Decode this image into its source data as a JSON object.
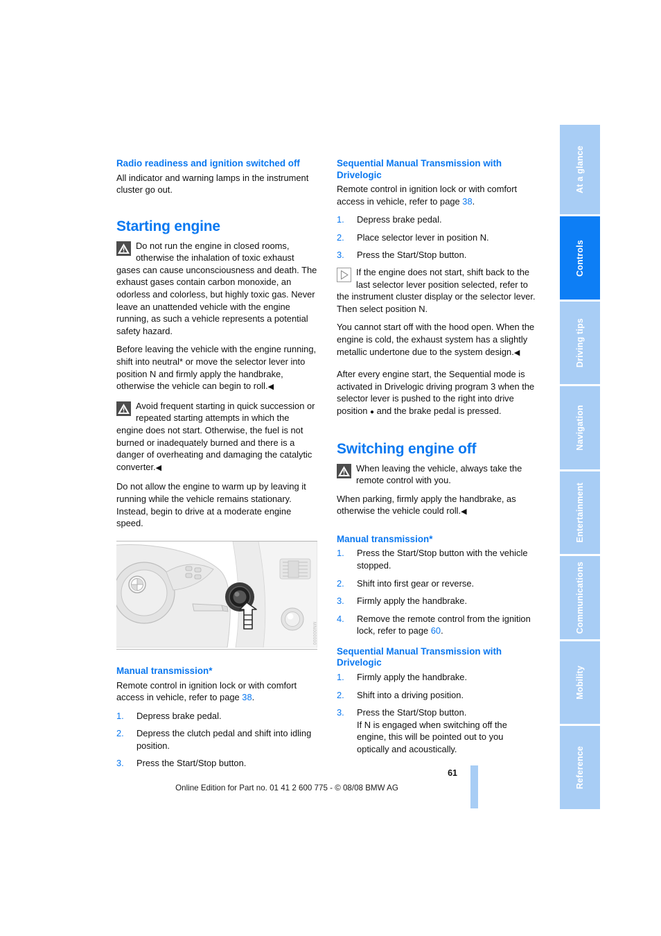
{
  "document": {
    "page_number": "61",
    "edition_line": "Online Edition for Part no. 01 41 2 600 775 - © 08/08 BMW AG",
    "accent_color": "#0a78f0",
    "tab_active_color": "#0d7ef5",
    "tab_inactive_color": "#a8cdf5"
  },
  "tabs": [
    {
      "label": "At a glance",
      "active": false
    },
    {
      "label": "Controls",
      "active": true
    },
    {
      "label": "Driving tips",
      "active": false
    },
    {
      "label": "Navigation",
      "active": false
    },
    {
      "label": "Entertainment",
      "active": false
    },
    {
      "label": "Communications",
      "active": false
    },
    {
      "label": "Mobility",
      "active": false
    },
    {
      "label": "Reference",
      "active": false
    }
  ],
  "left_column": {
    "radio_heading": "Radio readiness and ignition switched off",
    "radio_body": "All indicator and warning lamps in the instrument cluster go out.",
    "starting_engine_heading": "Starting engine",
    "warning1": "Do not run the engine in closed rooms, otherwise the inhalation of toxic exhaust gases can cause unconsciousness and death. The exhaust gases contain carbon monoxide, an odorless and colorless, but highly toxic gas. Never leave an unattended vehicle with the engine running, as such a vehicle represents a potential safety hazard.",
    "warning1_cont": "Before leaving the vehicle with the engine running, shift into neutral",
    "warning1_cont2": " or move the selector lever into position N and firmly apply the handbrake, otherwise the vehicle can begin to roll.",
    "warning2": "Avoid frequent starting in quick succession or repeated starting attempts in which the engine does not start. Otherwise, the fuel is not burned or inadequately burned and there is a danger of overheating and damaging the catalytic converter.",
    "warm_up_body": "Do not allow the engine to warm up by leaving it running while the vehicle remains stationary. Instead, begin to drive at a moderate engine speed.",
    "figure_code": "MN000000",
    "manual_heading": "Manual transmission*",
    "manual_intro_a": "Remote control in ignition lock or with comfort access in vehicle, refer to page ",
    "manual_intro_page": "38",
    "manual_intro_b": ".",
    "manual_steps": [
      {
        "num": "1.",
        "text": "Depress brake pedal."
      },
      {
        "num": "2.",
        "text": "Depress the clutch pedal and shift into idling position."
      },
      {
        "num": "3.",
        "text": "Press the Start/Stop button."
      }
    ]
  },
  "right_column": {
    "smg_heading": "Sequential Manual Transmission with Drivelogic",
    "smg_intro_a": "Remote control in ignition lock or with comfort access in vehicle, refer to page ",
    "smg_intro_page": "38",
    "smg_intro_b": ".",
    "smg_steps": [
      {
        "num": "1.",
        "text": "Depress brake pedal."
      },
      {
        "num": "2.",
        "text": "Place selector lever in position N."
      },
      {
        "num": "3.",
        "text": "Press the Start/Stop button."
      }
    ],
    "note1": "If the engine does not start, shift back to the last selector lever position selected, refer to the instrument cluster display or the selector lever. Then select position N.",
    "note1_cont": "You cannot start off with the hood open. When the engine is cold, the exhaust system has a slightly metallic undertone due to the system design.",
    "smg_after_a": "After every engine start, the Sequential mode is activated in Drivelogic driving program 3 when the selector lever is pushed to the right into drive position ",
    "smg_after_b": " and the brake pedal is pressed.",
    "switching_off_heading": "Switching engine off",
    "switch_warning": "When leaving the vehicle, always take the remote control with you.",
    "switch_warning_cont": "When parking, firmly apply the handbrake, as otherwise the vehicle could roll.",
    "manual_heading": "Manual transmission*",
    "manual_steps": [
      {
        "num": "1.",
        "text": "Press the Start/Stop button with the vehicle stopped."
      },
      {
        "num": "2.",
        "text": "Shift into first gear or reverse."
      },
      {
        "num": "3.",
        "text": "Firmly apply the handbrake."
      }
    ],
    "manual_step4_num": "4.",
    "manual_step4_a": "Remove the remote control from the ignition lock, refer to page ",
    "manual_step4_page": "60",
    "manual_step4_b": ".",
    "smg_off_heading": "Sequential Manual Transmission with Drivelogic",
    "smg_off_steps": [
      {
        "num": "1.",
        "text": "Firmly apply the handbrake."
      },
      {
        "num": "2.",
        "text": "Shift into a driving position."
      }
    ],
    "smg_off_step3_num": "3.",
    "smg_off_step3_text": "Press the Start/Stop button.",
    "smg_off_step3_note": "If N is engaged when switching off the engine, this will be pointed out to you optically and acoustically."
  },
  "symbols": {
    "end_mark": "◀",
    "asterisk": "*",
    "bullet": "●"
  }
}
